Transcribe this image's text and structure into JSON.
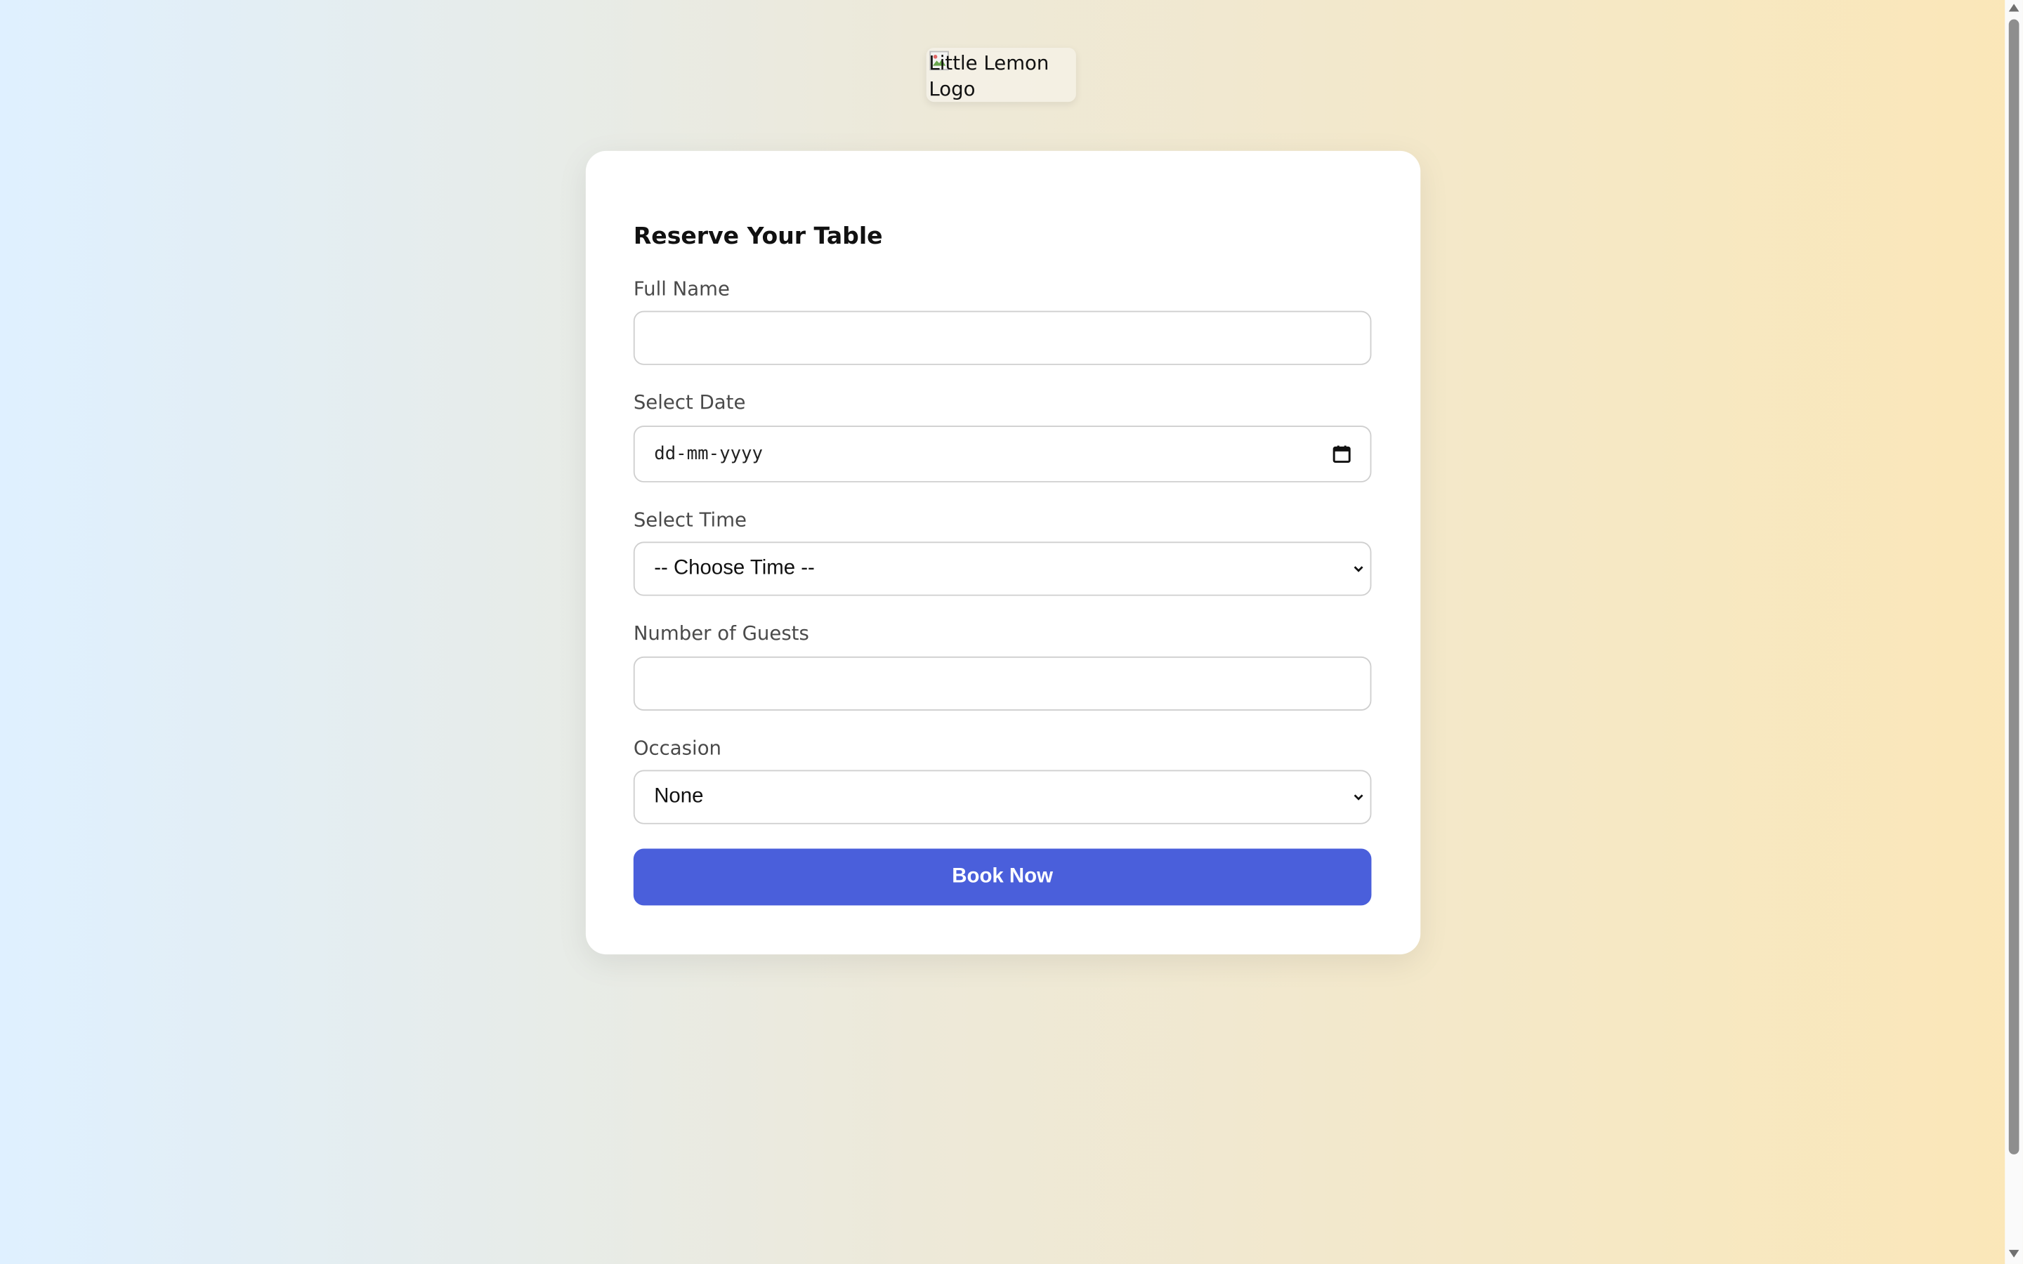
{
  "logo": {
    "alt_text": "Little Lemon Logo"
  },
  "form": {
    "title": "Reserve Your Table",
    "full_name": {
      "label": "Full Name",
      "value": ""
    },
    "date": {
      "label": "Select Date",
      "placeholder": "dd-mm-yyyy"
    },
    "time": {
      "label": "Select Time",
      "selected": "-- Choose Time --"
    },
    "guests": {
      "label": "Number of Guests",
      "value": ""
    },
    "occasion": {
      "label": "Occasion",
      "selected": "None"
    },
    "submit_label": "Book Now"
  },
  "icons": {
    "date_picker": "calendar-icon",
    "select_arrow": "chevron-down-icon",
    "broken_image": "broken-image-icon"
  },
  "colors": {
    "accent": "#4a5fdb",
    "card_background": "#ffffff",
    "background_left": "#dff0ff",
    "background_right": "#fbe7b8"
  }
}
